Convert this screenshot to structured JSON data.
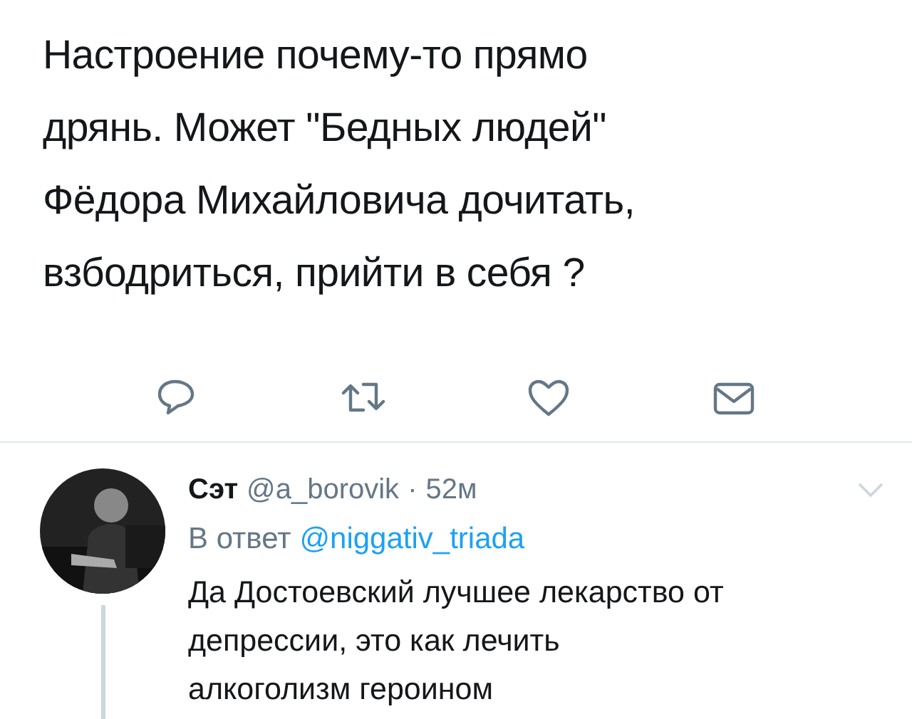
{
  "tweet": {
    "text": "Настроение почему-то прямо\nдрянь. Может \"Бедных людей\"\nФёдора Михайловича дочитать,\nвзбодриться, прийти в себя ?"
  },
  "actions": [
    {
      "kind": "reply"
    },
    {
      "kind": "retweet"
    },
    {
      "kind": "like"
    },
    {
      "kind": "message"
    }
  ],
  "reply": {
    "name": "Сэт",
    "handle": "@a_borovik",
    "separator": "·",
    "time": "52м",
    "in_reply_prefix": "В ответ",
    "in_reply_to": "@niggativ_triada",
    "text": "Да Достоевский лучшее лекарство от\nдепрессии, это как лечить\nалкоголизм героином"
  }
}
